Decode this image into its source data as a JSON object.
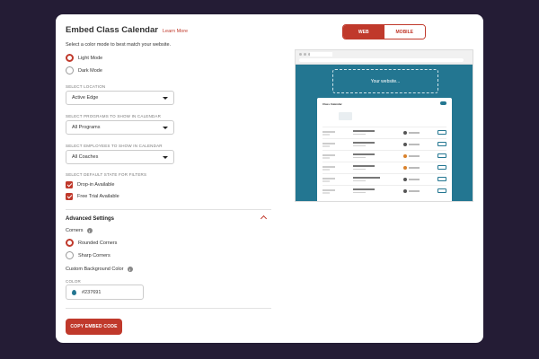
{
  "header": {
    "title": "Embed Class Calendar",
    "learn_more": "Learn More"
  },
  "color_mode": {
    "help": "Select a color mode to best match your website.",
    "options": [
      {
        "label": "Light Mode",
        "selected": true
      },
      {
        "label": "Dark Mode",
        "selected": false
      }
    ]
  },
  "location": {
    "label": "SELECT LOCATION",
    "value": "Active Edge"
  },
  "programs": {
    "label": "SELECT PROGRAMS TO SHOW IN CALENDAR",
    "value": "All Programs"
  },
  "employees": {
    "label": "SELECT EMPLOYEES TO SHOW IN CALENDAR",
    "value": "All Coaches"
  },
  "filters": {
    "label": "SELECT DEFAULT STATE FOR FILTERS",
    "items": [
      {
        "label": "Drop-in Available",
        "checked": true
      },
      {
        "label": "Free Trial Available",
        "checked": true
      }
    ]
  },
  "advanced": {
    "title": "Advanced Settings",
    "corners_label": "Corners",
    "corners": [
      {
        "label": "Rounded Corners",
        "selected": true
      },
      {
        "label": "Sharp Corners",
        "selected": false
      }
    ],
    "bg_label": "Custom Background Color",
    "color_label": "COLOR",
    "color_value": "#237691"
  },
  "copy_button": "COPY EMBED CODE",
  "preview": {
    "tabs": [
      "WEB",
      "MOBILE"
    ],
    "active_tab": "WEB",
    "website_text": "Your website...",
    "widget_title": "Class Calendar"
  },
  "colors": {
    "accent": "#c0392b",
    "preview_bg": "#237691",
    "page_bg": "#241c35"
  }
}
